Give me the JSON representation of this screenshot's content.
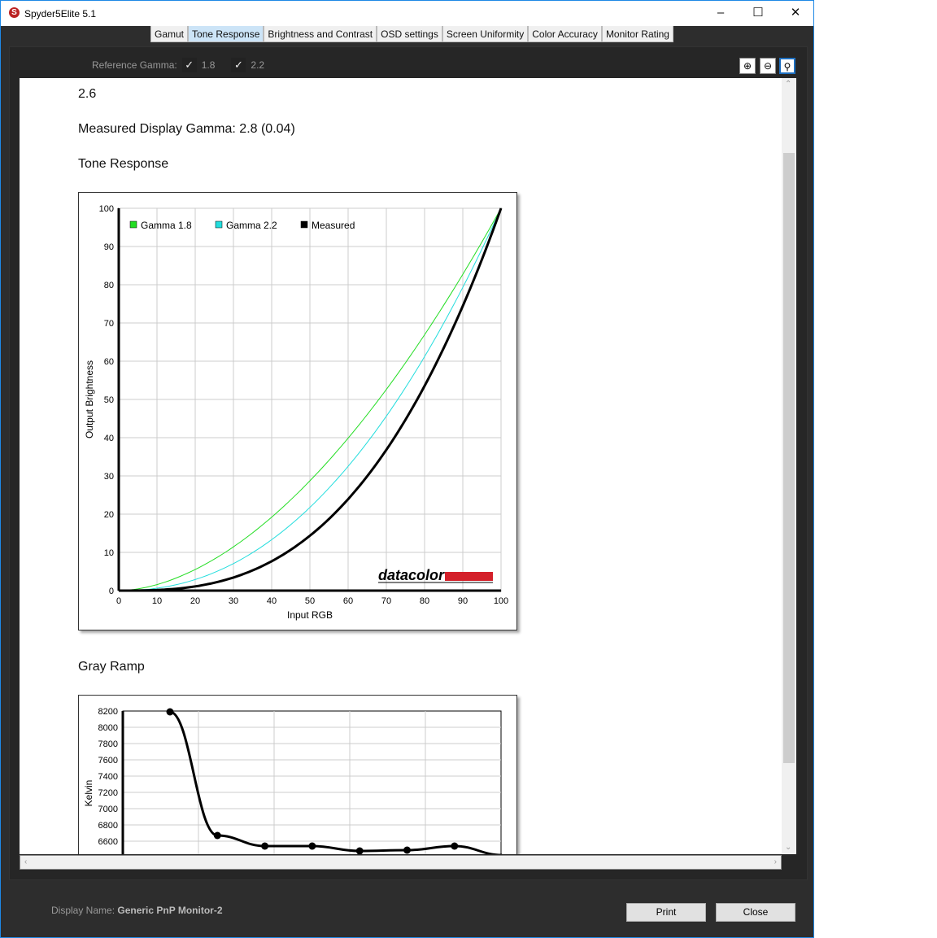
{
  "window": {
    "title": "Spyder5Elite 5.1"
  },
  "tabs": [
    "Gamut",
    "Tone Response",
    "Brightness and Contrast",
    "OSD settings",
    "Screen Uniformity",
    "Color Accuracy",
    "Monitor Rating"
  ],
  "active_tab": "Tone Response",
  "reference_gamma": {
    "label": "Reference Gamma:",
    "options": [
      {
        "value": "1.8",
        "checked": true
      },
      {
        "value": "2.2",
        "checked": true
      }
    ]
  },
  "zoom_buttons": [
    "zoom-in-icon",
    "zoom-out-icon",
    "zoom-fit-icon"
  ],
  "content": {
    "gamma_value": "2.6",
    "measured": "Measured Display Gamma: 2.8 (0.04)",
    "tone_title": "Tone Response",
    "gray_title": "Gray Ramp"
  },
  "chart_data": [
    {
      "type": "line",
      "title": "Tone Response",
      "xlabel": "Input RGB",
      "ylabel": "Output Brightness",
      "xlim": [
        0,
        100
      ],
      "ylim": [
        0,
        100
      ],
      "xticks": [
        "0",
        "10",
        "20",
        "30",
        "40",
        "50",
        "60",
        "70",
        "80",
        "90",
        "100"
      ],
      "yticks": [
        "0",
        "10",
        "20",
        "30",
        "40",
        "50",
        "60",
        "70",
        "80",
        "90",
        "100"
      ],
      "legend": "top-left",
      "grid": true,
      "series": [
        {
          "name": "Gamma 1.8",
          "gamma": 1.8,
          "color": "#22dd22"
        },
        {
          "name": "Gamma 2.2",
          "gamma": 2.2,
          "color": "#22dddd"
        },
        {
          "name": "Measured",
          "gamma": 2.8,
          "color": "#000000"
        }
      ],
      "brand": "datacolor"
    },
    {
      "type": "line",
      "title": "Gray Ramp",
      "ylabel": "Kelvin",
      "ylim": [
        6400,
        8200
      ],
      "yticks": [
        "8200",
        "8000",
        "7800",
        "7600",
        "7400",
        "7200",
        "7000",
        "6800",
        "6600"
      ],
      "values": [
        8190,
        6670,
        6540,
        6540,
        6480,
        6490,
        6540,
        6430
      ]
    }
  ],
  "footer": {
    "display_label": "Display Name:",
    "display_name": "Generic PnP Monitor-2",
    "print": "Print",
    "close": "Close"
  }
}
